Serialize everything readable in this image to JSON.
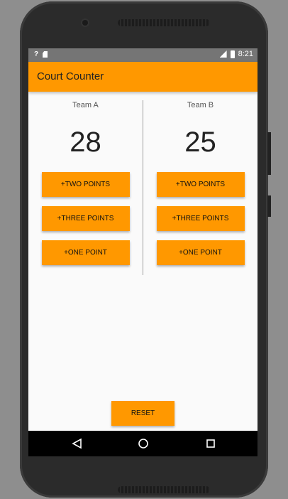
{
  "status_bar": {
    "time": "8:21",
    "icons": [
      "question-icon",
      "sd-card-icon",
      "signal-icon",
      "battery-icon"
    ]
  },
  "app_bar": {
    "title": "Court Counter"
  },
  "team_a": {
    "name": "Team A",
    "score": "28",
    "buttons": [
      "+TWO POINTS",
      "+THREE POINTS",
      "+ONE POINT"
    ]
  },
  "team_b": {
    "name": "Team B",
    "score": "25",
    "buttons": [
      "+TWO POINTS",
      "+THREE POINTS",
      "+ONE POINT"
    ]
  },
  "reset_label": "RESET",
  "nav_bar": {
    "icons": [
      "back-icon",
      "home-icon",
      "recent-apps-icon"
    ]
  },
  "colors": {
    "accent": "#ff9800",
    "status_bar": "#757575",
    "background": "#fafafa"
  }
}
